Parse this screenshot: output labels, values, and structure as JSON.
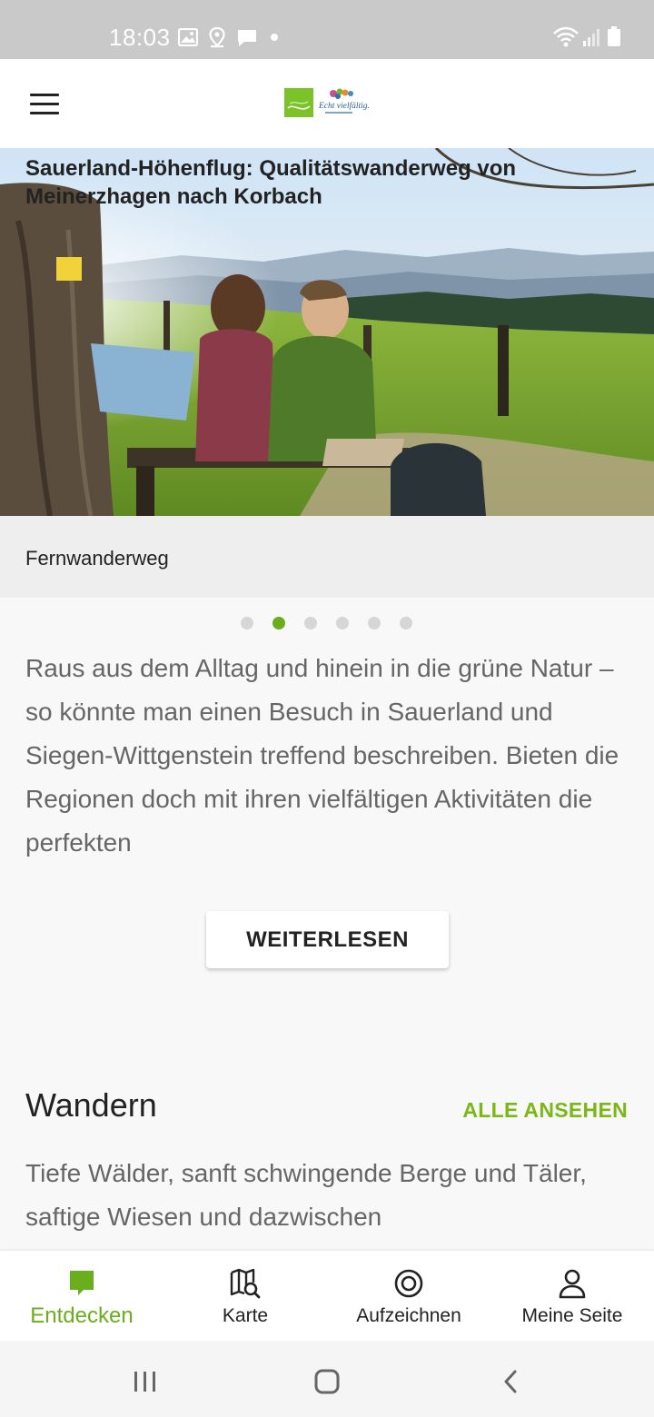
{
  "status_bar": {
    "time": "18:03",
    "icons": [
      "image-icon",
      "location-icon",
      "message-icon",
      "wifi-icon",
      "signal-icon",
      "battery-icon"
    ]
  },
  "app_bar": {
    "menu_icon": "hamburger-icon",
    "logo_text": "Echt vielfältig."
  },
  "hero": {
    "title": "Sauerland-Höhenflug: Qualitätswanderweg von Meinerzhagen nach Korbach",
    "category": "Fernwanderweg",
    "pager_count": 6,
    "pager_active": 1
  },
  "intro": {
    "text": "Raus aus dem Alltag und hinein in die grüne Natur – so könnte man einen Besuch in Sauerland und Siegen-Wittgenstein treffend beschreiben. Bieten die Regionen doch mit ihren vielfältigen Aktivitäten die perfekten",
    "button_label": "WEITERLESEN"
  },
  "section": {
    "title": "Wandern",
    "see_all_label": "ALLE ANSEHEN",
    "text": "Tiefe Wälder, sanft schwingende Berge und Täler, saftige Wiesen und dazwischen"
  },
  "bottom_nav": {
    "items": [
      {
        "label": "Entdecken",
        "icon": "discover-icon",
        "active": true
      },
      {
        "label": "Karte",
        "icon": "map-search-icon",
        "active": false
      },
      {
        "label": "Aufzeichnen",
        "icon": "record-icon",
        "active": false
      },
      {
        "label": "Meine Seite",
        "icon": "user-icon",
        "active": false
      }
    ]
  },
  "colors": {
    "accent": "#7cb718",
    "active_nav": "#6aad1d",
    "status_bar": "#c9c9c9"
  }
}
